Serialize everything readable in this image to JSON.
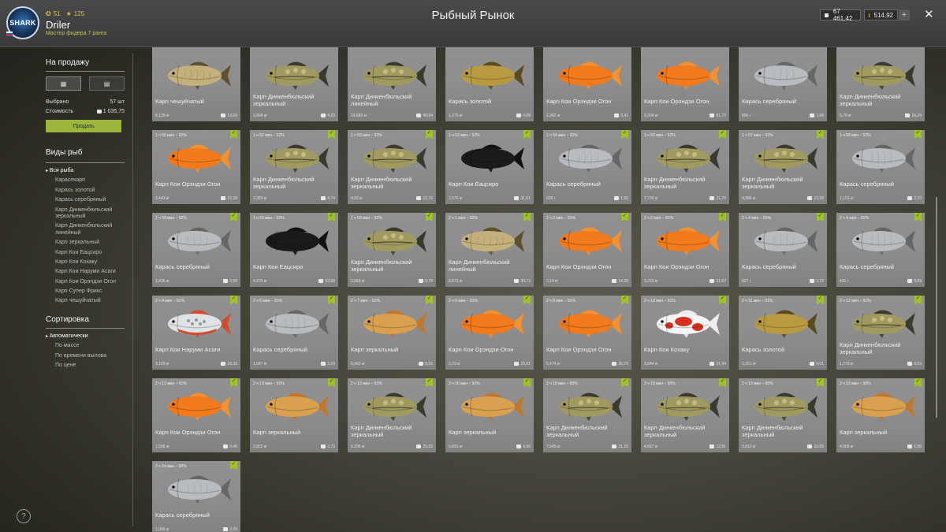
{
  "header": {
    "avatar_text": "SHARK",
    "stat1": "51",
    "stat2": "125",
    "username": "Driler",
    "rank": "Мастер фидера 7 ранга",
    "title": "Рыбный Рынок",
    "currency1": "67 461,42",
    "currency2": "514,92",
    "plus": "+",
    "close": "✕"
  },
  "sidebar": {
    "sale_title": "На продажу",
    "selected_label": "Выбрано",
    "selected_value": "57 шт",
    "cost_label": "Стоимость",
    "cost_value": "1 035,75",
    "sell_label": "Продать",
    "fish_types_title": "Виды рыб",
    "fish_types": [
      "Вся рыба",
      "Карасекарп",
      "Карась золотой",
      "Карась серебряный",
      "Карп Динкенбюльский зеркальный",
      "Карп Динкенбюльский линейный",
      "Карп зеркальный",
      "Карп Кои Еацсиро",
      "Карп Кои Кохаку",
      "Карп Кои Наруми Асаги",
      "Карп Кои Орэндзи Огон",
      "Карп Супер Фрикс",
      "Карп чешуйчатый"
    ],
    "sort_title": "Сортировка",
    "sort_options": [
      "Автоматически",
      "По массе",
      "По времени вылова",
      "По цене"
    ]
  },
  "help": "?",
  "fish_cards": [
    {
      "time": "",
      "name": "Карп чешуйчатый",
      "weight": "8,139 кг",
      "price": "13,69",
      "kind": "scaly",
      "checked": false
    },
    {
      "time": "",
      "name": "Карп Динкенбюльский зеркальный",
      "weight": "3,094 кг",
      "price": "4,33",
      "kind": "mirror",
      "checked": false
    },
    {
      "time": "",
      "name": "Карп Динкенбюльский линейный",
      "weight": "10,683 кг",
      "price": "49,94",
      "kind": "mirror",
      "checked": false
    },
    {
      "time": "",
      "name": "Карась золотой",
      "weight": "1,275 кг",
      "price": "4,08",
      "kind": "goldcarp",
      "checked": false
    },
    {
      "time": "",
      "name": "Карп Кои Орэндзи Огон",
      "weight": "1,382 кг",
      "price": "0,41",
      "kind": "orange",
      "checked": false
    },
    {
      "time": "",
      "name": "Карп Кои Орэндзи Огон",
      "weight": "9,204 кг",
      "price": "61,72",
      "kind": "orange",
      "checked": false
    },
    {
      "time": "",
      "name": "Карась серебряный",
      "weight": "806 г",
      "price": "1,68",
      "kind": "silver",
      "checked": false
    },
    {
      "time": "",
      "name": "Карп Динкенбюльский зеркальный",
      "weight": "5,79 кг",
      "price": "16,24",
      "kind": "mirror",
      "checked": false
    },
    {
      "time": "1 ч 50 мин – 92%",
      "name": "Карп Кои Орэндзи Огон",
      "weight": "2,443 кг",
      "price": "16,38",
      "kind": "orange",
      "checked": true
    },
    {
      "time": "1 ч 52 мин – 92%",
      "name": "Карп Динкенбюльский зеркальный",
      "weight": "3,383 кг",
      "price": "4,74",
      "kind": "mirror",
      "checked": true
    },
    {
      "time": "1 ч 53 мин – 92%",
      "name": "Карп Динкенбюльский зеркальный",
      "weight": "4,55 кг",
      "price": "12,76",
      "kind": "mirror",
      "checked": true
    },
    {
      "time": "1 ч 53 мин – 92%",
      "name": "Карп Кои Еацсиро",
      "weight": "2,576 кг",
      "price": "31,61",
      "kind": "black",
      "checked": true
    },
    {
      "time": "1 ч 54 мин – 92%",
      "name": "Карась серебряный",
      "weight": "939 г",
      "price": "1,95",
      "kind": "silver",
      "checked": true
    },
    {
      "time": "1 ч 56 мин – 92%",
      "name": "Карп Динкенбюльский зеркальный",
      "weight": "7,739 кг",
      "price": "21,70",
      "kind": "mirror",
      "checked": true
    },
    {
      "time": "1 ч 57 мин – 92%",
      "name": "Карп Динкенбюльский зеркальный",
      "weight": "4,986 кг",
      "price": "13,98",
      "kind": "mirror",
      "checked": true
    },
    {
      "time": "1 ч 58 мин – 92%",
      "name": "Карась серебряный",
      "weight": "1,119 кг",
      "price": "2,33",
      "kind": "silver",
      "checked": true
    },
    {
      "time": "1 ч 59 мин – 92%",
      "name": "Карась серебряный",
      "weight": "1,436 кг",
      "price": "2,99",
      "kind": "silver",
      "checked": true
    },
    {
      "time": "1 ч 59 мин – 92%",
      "name": "Карп Кои Еацсиро",
      "weight": "4,375 кг",
      "price": "53,68",
      "kind": "black",
      "checked": true
    },
    {
      "time": "1 ч 59 мин – 92%",
      "name": "Карп Динкенбюльский зеркальный",
      "weight": "2,663 кг",
      "price": "0,79",
      "kind": "mirror",
      "checked": true
    },
    {
      "time": "2 ч 1 мин – 92%",
      "name": "Карп Динкенбюльский линейный",
      "weight": "6,572 кг",
      "price": "30,72",
      "kind": "scaly",
      "checked": true
    },
    {
      "time": "2 ч 2 мин – 91%",
      "name": "Карп Кои Орэндзи Огон",
      "weight": "2,14 кг",
      "price": "14,35",
      "kind": "orange",
      "checked": true
    },
    {
      "time": "2 ч 2 мин – 91%",
      "name": "Карп Кои Орэндзи Огон",
      "weight": "3,233 кг",
      "price": "21,67",
      "kind": "orange",
      "checked": true
    },
    {
      "time": "2 ч 4 мин – 91%",
      "name": "Карась серебряный",
      "weight": "827 г",
      "price": "1,72",
      "kind": "silver",
      "checked": true
    },
    {
      "time": "2 ч 4 мин – 91%",
      "name": "Карась серебряный",
      "weight": "431 г",
      "price": "0,89",
      "kind": "silver",
      "checked": true
    },
    {
      "time": "2 ч 4 мин – 91%",
      "name": "Карп Кои Наруми Асаги",
      "weight": "3,169 кг",
      "price": "33,33",
      "kind": "asagi",
      "checked": true
    },
    {
      "time": "2 ч 6 мин – 91%",
      "name": "Карась серебряный",
      "weight": "1,047 кг",
      "price": "2,18",
      "kind": "silver",
      "checked": true
    },
    {
      "time": "2 ч 7 мин – 91%",
      "name": "Карп зеркальный",
      "weight": "6,062 кг",
      "price": "8,50",
      "kind": "golden",
      "checked": true
    },
    {
      "time": "2 ч 8 мин – 91%",
      "name": "Карп Кои Орэндзи Огон",
      "weight": "3,73 кг",
      "price": "25,01",
      "kind": "orange",
      "checked": true
    },
    {
      "time": "2 ч 9 мин – 91%",
      "name": "Карп Кои Орэндзи Огон",
      "weight": "5,474 кг",
      "price": "36,70",
      "kind": "orange",
      "checked": true
    },
    {
      "time": "2 ч 10 мин – 91%",
      "name": "Карп Кои Кохаку",
      "weight": "3,644 кг",
      "price": "31,94",
      "kind": "kohaku",
      "checked": true
    },
    {
      "time": "2 ч 11 мин – 91%",
      "name": "Карась золотой",
      "weight": "1,251 кг",
      "price": "4,01",
      "kind": "goldcarp",
      "checked": true
    },
    {
      "time": "2 ч 12 мин – 91%",
      "name": "Карп Динкенбюльский зеркальный",
      "weight": "1,779 кг",
      "price": "0,53",
      "kind": "mirror",
      "checked": true
    },
    {
      "time": "2 ч 13 мин – 91%",
      "name": "Карп Кои Орэндзи Огон",
      "weight": "1,556 кг",
      "price": "0,46",
      "kind": "orange",
      "checked": true
    },
    {
      "time": "2 ч 13 мин – 91%",
      "name": "Карп зеркальный",
      "weight": "3,902 кг",
      "price": "2,73",
      "kind": "golden",
      "checked": true
    },
    {
      "time": "2 ч 13 мин – 91%",
      "name": "Карп Динкенбюльский зеркальный",
      "weight": "9,206 кг",
      "price": "25,82",
      "kind": "mirror",
      "checked": true
    },
    {
      "time": "2 ч 16 мин – 91%",
      "name": "Карп зеркальный",
      "weight": "6,891 кг",
      "price": "9,66",
      "kind": "golden",
      "checked": true
    },
    {
      "time": "2 ч 18 мин – 90%",
      "name": "Карп Динкенбюльский зеркальный",
      "weight": "7,545 кг",
      "price": "21,16",
      "kind": "mirror",
      "checked": true
    },
    {
      "time": "2 ч 19 мин – 90%",
      "name": "Карп Динкенбюльский зеркальный",
      "weight": "4,567 кг",
      "price": "12,81",
      "kind": "mirror",
      "checked": true
    },
    {
      "time": "2 ч 19 мин – 90%",
      "name": "Карп Динкенбюльский зеркальный",
      "weight": "3,813 кг",
      "price": "10,69",
      "kind": "mirror",
      "checked": true
    },
    {
      "time": "2 ч 23 мин – 90%",
      "name": "Карп зеркальный",
      "weight": "4,906 кг",
      "price": "6,88",
      "kind": "golden",
      "checked": true
    },
    {
      "time": "2 ч 24 мин – 90%",
      "name": "Карась серебряный",
      "weight": "1,006 кг",
      "price": "2,09",
      "kind": "silver",
      "checked": true
    }
  ],
  "colors": {
    "accent": "#9bb63a",
    "orange": "#f07a1c",
    "black": "#1a1a1a",
    "silver": "#b8bcc0",
    "mirror": "#a09a60",
    "golden": "#d9a050",
    "goldcarp": "#b89a40",
    "scaly": "#c4b07a",
    "asagi": "#d64a30",
    "kohaku": "#f4f4f4"
  }
}
